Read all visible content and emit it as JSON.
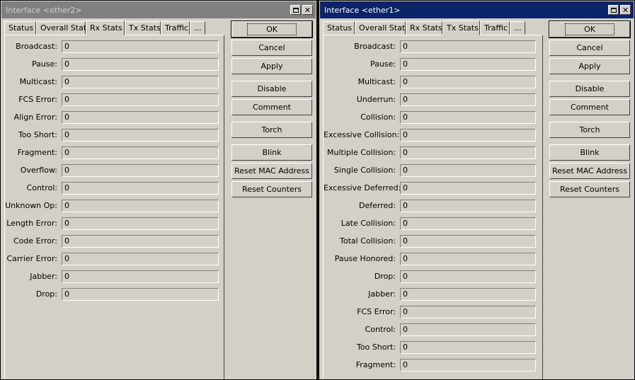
{
  "left": {
    "title": "Interface <ether2>",
    "tabs": [
      "Status",
      "Overall Stats",
      "Rx Stats",
      "Tx Stats",
      "Traffic",
      "..."
    ],
    "fields": [
      {
        "label": "Broadcast:",
        "value": "0"
      },
      {
        "label": "Pause:",
        "value": "0"
      },
      {
        "label": "Multicast:",
        "value": "0"
      },
      {
        "label": "FCS Error:",
        "value": "0"
      },
      {
        "label": "Align Error:",
        "value": "0"
      },
      {
        "label": "Too Short:",
        "value": "0"
      },
      {
        "label": "Fragment:",
        "value": "0"
      },
      {
        "label": "Overflow:",
        "value": "0"
      },
      {
        "label": "Control:",
        "value": "0"
      },
      {
        "label": "Unknown Op:",
        "value": "0"
      },
      {
        "label": "Length Error:",
        "value": "0"
      },
      {
        "label": "Code Error:",
        "value": "0"
      },
      {
        "label": "Carrier Error:",
        "value": "0"
      },
      {
        "label": "Jabber:",
        "value": "0"
      },
      {
        "label": "Drop:",
        "value": "0"
      }
    ]
  },
  "right": {
    "title": "Interface <ether1>",
    "tabs": [
      "Status",
      "Overall Stats",
      "Rx Stats",
      "Tx Stats",
      "Traffic",
      "..."
    ],
    "fields": [
      {
        "label": "Broadcast:",
        "value": "0"
      },
      {
        "label": "Pause:",
        "value": "0"
      },
      {
        "label": "Multicast:",
        "value": "0"
      },
      {
        "label": "Underrun:",
        "value": "0"
      },
      {
        "label": "Collision:",
        "value": "0"
      },
      {
        "label": "Excessive Collision:",
        "value": "0"
      },
      {
        "label": "Multiple Collision:",
        "value": "0"
      },
      {
        "label": "Single Collision:",
        "value": "0"
      },
      {
        "label": "Excessive Deferred:",
        "value": "0"
      },
      {
        "label": "Deferred:",
        "value": "0"
      },
      {
        "label": "Late Collision:",
        "value": "0"
      },
      {
        "label": "Total Collision:",
        "value": "0"
      },
      {
        "label": "Pause Honored:",
        "value": "0"
      },
      {
        "label": "Drop:",
        "value": "0"
      },
      {
        "label": "Jabber:",
        "value": "0"
      },
      {
        "label": "FCS Error:",
        "value": "0"
      },
      {
        "label": "Control:",
        "value": "0"
      },
      {
        "label": "Too Short:",
        "value": "0"
      },
      {
        "label": "Fragment:",
        "value": "0"
      }
    ]
  },
  "buttons": {
    "ok": "OK",
    "cancel": "Cancel",
    "apply": "Apply",
    "disable": "Disable",
    "comment": "Comment",
    "torch": "Torch",
    "blink": "Blink",
    "reset_mac": "Reset MAC Address",
    "reset_counters": "Reset Counters"
  },
  "icons": {
    "maximize": "maximize-icon",
    "close": "close-icon"
  },
  "colors": {
    "window_bg": "#d4d0c8",
    "active_title": "#0a246a",
    "inactive_title": "#808080"
  }
}
